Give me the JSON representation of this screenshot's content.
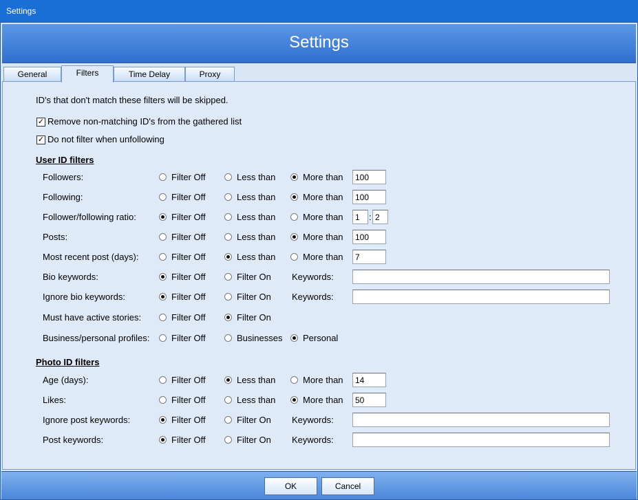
{
  "window": {
    "title": "Settings"
  },
  "header": {
    "title": "Settings"
  },
  "tabs": [
    {
      "label": "General"
    },
    {
      "label": "Filters"
    },
    {
      "label": "Time Delay"
    },
    {
      "label": "Proxy"
    }
  ],
  "filters": {
    "intro": "ID's that don't match these filters will be skipped.",
    "remove_nonmatching": {
      "label": "Remove non-matching ID's from the gathered list",
      "checked": true
    },
    "no_filter_unfollowing": {
      "label": "Do not filter when unfollowing",
      "checked": true
    },
    "user_section": "User ID filters",
    "photo_section": "Photo ID filters",
    "rows": {
      "followers": {
        "label": "Followers:",
        "opt1": "Filter Off",
        "opt2": "Less than",
        "opt3": "More than",
        "selected": 3,
        "value": "100"
      },
      "following": {
        "label": "Following:",
        "opt1": "Filter Off",
        "opt2": "Less than",
        "opt3": "More than",
        "selected": 3,
        "value": "100"
      },
      "ratio": {
        "label": "Follower/following ratio:",
        "opt1": "Filter Off",
        "opt2": "Less than",
        "opt3": "More than",
        "selected": 1,
        "value1": "1",
        "sep": ":",
        "value2": "2"
      },
      "posts": {
        "label": "Posts:",
        "opt1": "Filter Off",
        "opt2": "Less than",
        "opt3": "More than",
        "selected": 3,
        "value": "100"
      },
      "recent_post": {
        "label": "Most recent post (days):",
        "opt1": "Filter Off",
        "opt2": "Less than",
        "opt3": "More than",
        "selected": 2,
        "value": "7"
      },
      "bio_keywords": {
        "label": "Bio keywords:",
        "opt1": "Filter Off",
        "opt2": "Filter On",
        "kw_label": "Keywords:",
        "selected": 1,
        "value": ""
      },
      "ignore_bio": {
        "label": "Ignore bio keywords:",
        "opt1": "Filter Off",
        "opt2": "Filter On",
        "kw_label": "Keywords:",
        "selected": 1,
        "value": ""
      },
      "active_stories": {
        "label": "Must have active stories:",
        "opt1": "Filter Off",
        "opt2": "Filter On",
        "selected": 2
      },
      "profiles": {
        "label": "Business/personal profiles:",
        "opt1": "Filter Off",
        "opt2": "Businesses",
        "opt3": "Personal",
        "selected": 3
      },
      "age": {
        "label": "Age (days):",
        "opt1": "Filter Off",
        "opt2": "Less than",
        "opt3": "More than",
        "selected": 2,
        "value": "14"
      },
      "likes": {
        "label": "Likes:",
        "opt1": "Filter Off",
        "opt2": "Less than",
        "opt3": "More than",
        "selected": 3,
        "value": "50"
      },
      "ignore_post": {
        "label": "Ignore post keywords:",
        "opt1": "Filter Off",
        "opt2": "Filter On",
        "kw_label": "Keywords:",
        "selected": 1,
        "value": ""
      },
      "post_keywords": {
        "label": "Post keywords:",
        "opt1": "Filter Off",
        "opt2": "Filter On",
        "kw_label": "Keywords:",
        "selected": 1,
        "value": ""
      }
    }
  },
  "footer": {
    "ok": "OK",
    "cancel": "Cancel"
  }
}
